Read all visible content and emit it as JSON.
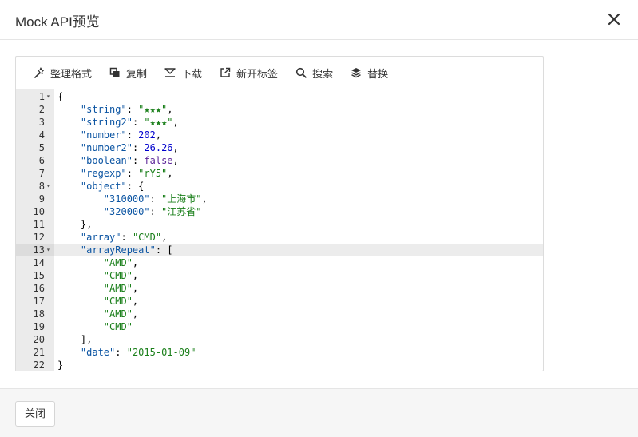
{
  "modal": {
    "title": "Mock API预览",
    "close_icon": "close-icon"
  },
  "toolbar": {
    "items": [
      {
        "label": "整理格式",
        "icon": "magic-wand-icon"
      },
      {
        "label": "复制",
        "icon": "copy-icon"
      },
      {
        "label": "下载",
        "icon": "download-icon"
      },
      {
        "label": "新开标签",
        "icon": "external-link-icon"
      },
      {
        "label": "搜索",
        "icon": "search-icon"
      },
      {
        "label": "替换",
        "icon": "layers-icon"
      }
    ]
  },
  "editor": {
    "active_line": 13,
    "lines": [
      {
        "n": "1",
        "fold": true,
        "text": "{"
      },
      {
        "n": "2",
        "fold": false,
        "text": "    \"string\": \"★★★\","
      },
      {
        "n": "3",
        "fold": false,
        "text": "    \"string2\": \"★★★\","
      },
      {
        "n": "4",
        "fold": false,
        "text": "    \"number\": 202,"
      },
      {
        "n": "5",
        "fold": false,
        "text": "    \"number2\": 26.26,"
      },
      {
        "n": "6",
        "fold": false,
        "text": "    \"boolean\": false,"
      },
      {
        "n": "7",
        "fold": false,
        "text": "    \"regexp\": \"rY5\","
      },
      {
        "n": "8",
        "fold": true,
        "text": "    \"object\": {"
      },
      {
        "n": "9",
        "fold": false,
        "text": "        \"310000\": \"上海市\","
      },
      {
        "n": "10",
        "fold": false,
        "text": "        \"320000\": \"江苏省\""
      },
      {
        "n": "11",
        "fold": false,
        "text": "    },"
      },
      {
        "n": "12",
        "fold": false,
        "text": "    \"array\": \"CMD\","
      },
      {
        "n": "13",
        "fold": true,
        "text": "    \"arrayRepeat\": ["
      },
      {
        "n": "14",
        "fold": false,
        "text": "        \"AMD\","
      },
      {
        "n": "15",
        "fold": false,
        "text": "        \"CMD\","
      },
      {
        "n": "16",
        "fold": false,
        "text": "        \"AMD\","
      },
      {
        "n": "17",
        "fold": false,
        "text": "        \"CMD\","
      },
      {
        "n": "18",
        "fold": false,
        "text": "        \"AMD\","
      },
      {
        "n": "19",
        "fold": false,
        "text": "        \"CMD\""
      },
      {
        "n": "20",
        "fold": false,
        "text": "    ],"
      },
      {
        "n": "21",
        "fold": false,
        "text": "    \"date\": \"2015-01-09\""
      },
      {
        "n": "22",
        "fold": false,
        "text": "}"
      }
    ]
  },
  "footer": {
    "close_label": "关闭"
  }
}
